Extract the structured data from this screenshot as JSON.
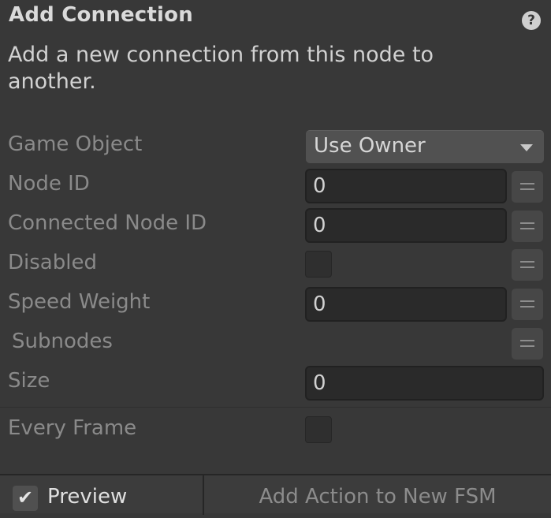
{
  "header": {
    "title": "Add Connection",
    "help_icon": "?",
    "description": "Add a new connection from this node to another."
  },
  "fields": {
    "game_object": {
      "label": "Game Object",
      "value": "Use Owner"
    },
    "node_id": {
      "label": "Node ID",
      "value": "0"
    },
    "connected_node_id": {
      "label": "Connected Node ID",
      "value": "0"
    },
    "disabled": {
      "label": "Disabled",
      "checked": false
    },
    "speed_weight": {
      "label": "Speed Weight",
      "value": "0"
    },
    "subnodes": {
      "label": "Subnodes"
    },
    "size": {
      "label": "Size",
      "value": "0"
    },
    "every_frame": {
      "label": "Every Frame",
      "checked": false
    }
  },
  "footer": {
    "preview_check": "✔",
    "preview_label": "Preview",
    "preview_checked": true,
    "add_fsm_label": "Add Action to New FSM"
  },
  "icons": {
    "help": "help-icon",
    "dropdown": "chevron-down-icon",
    "menu": "hamburger-menu-icon"
  }
}
